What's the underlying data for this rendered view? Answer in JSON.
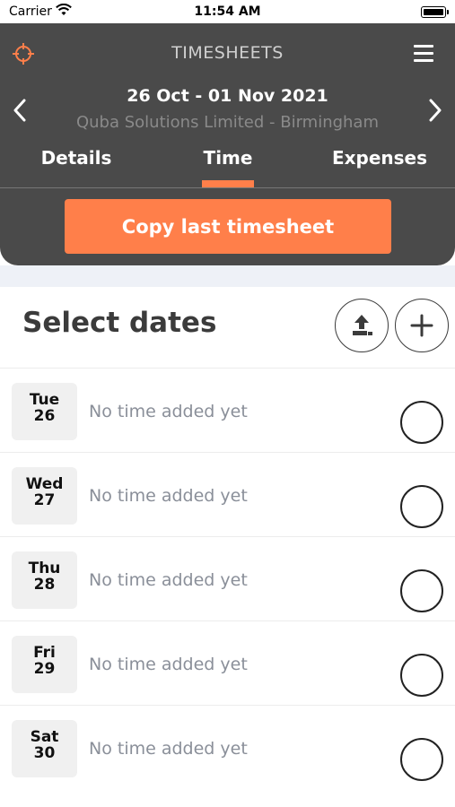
{
  "status_bar": {
    "carrier": "Carrier",
    "time": "11:54 AM"
  },
  "header": {
    "title": "TIMESHEETS",
    "date_range": "26 Oct - 01 Nov 2021",
    "company": "Quba Solutions Limited - Birmingham",
    "tabs": [
      {
        "label": "Details"
      },
      {
        "label": "Time",
        "active": true
      },
      {
        "label": "Expenses"
      }
    ],
    "copy_button": "Copy last timesheet"
  },
  "colors": {
    "accent": "#ff7f4a",
    "header_bg": "#4a4a4a"
  },
  "section": {
    "title": "Select dates"
  },
  "dates": [
    {
      "day": "Tue",
      "num": "26",
      "note": "No time added yet"
    },
    {
      "day": "Wed",
      "num": "27",
      "note": "No time added yet"
    },
    {
      "day": "Thu",
      "num": "28",
      "note": "No time added yet"
    },
    {
      "day": "Fri",
      "num": "29",
      "note": "No time added yet"
    },
    {
      "day": "Sat",
      "num": "30",
      "note": "No time added yet"
    }
  ]
}
